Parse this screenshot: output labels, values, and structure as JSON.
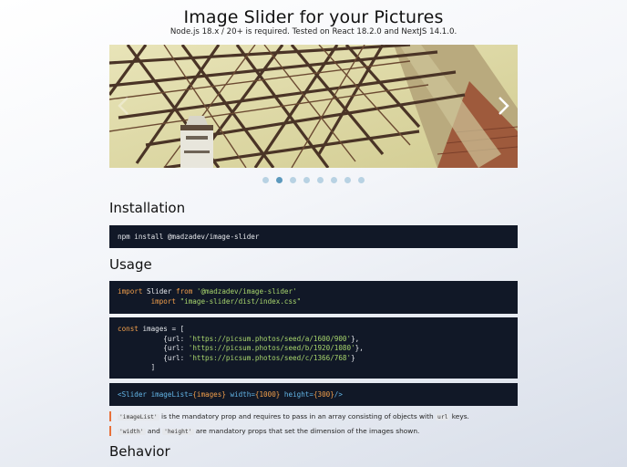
{
  "header": {
    "title": "Image Slider for your Pictures",
    "subtitle": "Node.js 18.x / 20+ is required. Tested on React 18.2.0 and NextJS 14.1.0."
  },
  "slider": {
    "image_icon": "bridge-photo",
    "prev_icon": "chevron-left-icon",
    "next_icon": "chevron-right-icon",
    "slide_count": 8,
    "active_index": 1
  },
  "installation": {
    "heading": "Installation",
    "command": "npm install @madzadev/image-slider"
  },
  "usage": {
    "heading": "Usage",
    "import_block": {
      "kw_import": "import",
      "ident": "Slider",
      "kw_from": "from",
      "module": "'@madzadev/image-slider'",
      "kw_import2": "import",
      "css_path": "\"image-slider/dist/index.css\""
    },
    "images_block": {
      "kw_const": "const",
      "decl": "images = [",
      "urls": [
        "'https://picsum.photos/seed/a/1600/900'",
        "'https://picsum.photos/seed/b/1920/1080'",
        "'https://picsum.photos/seed/c/1366/768'"
      ],
      "url_key": "url:",
      "close": "]"
    },
    "jsx_block": {
      "open": "<Slider",
      "prop1": "imageList=",
      "val1": "{images}",
      "prop2": "width=",
      "val2": "{1000}",
      "prop3": "height=",
      "val3": "{300}",
      "close": "/>"
    },
    "notes": [
      {
        "code": "'imageList'",
        "text": " is the mandatory prop and requires to pass in an array consisting of objects with ",
        "code2": "url",
        "text2": " keys."
      },
      {
        "code": "'width'",
        "mid": " and ",
        "code2": "'height'",
        "text2": " are mandatory props that set the dimension of the images shown."
      }
    ]
  },
  "behavior": {
    "heading": "Behavior"
  },
  "colors": {
    "code_bg": "#111827",
    "keyword": "#f29f4b",
    "string": "#a8d66d",
    "jsx": "#63b6e8",
    "dot_active": "#5c99bd",
    "dot_inactive": "#b8d2e3",
    "note_accent": "#e8713a"
  }
}
